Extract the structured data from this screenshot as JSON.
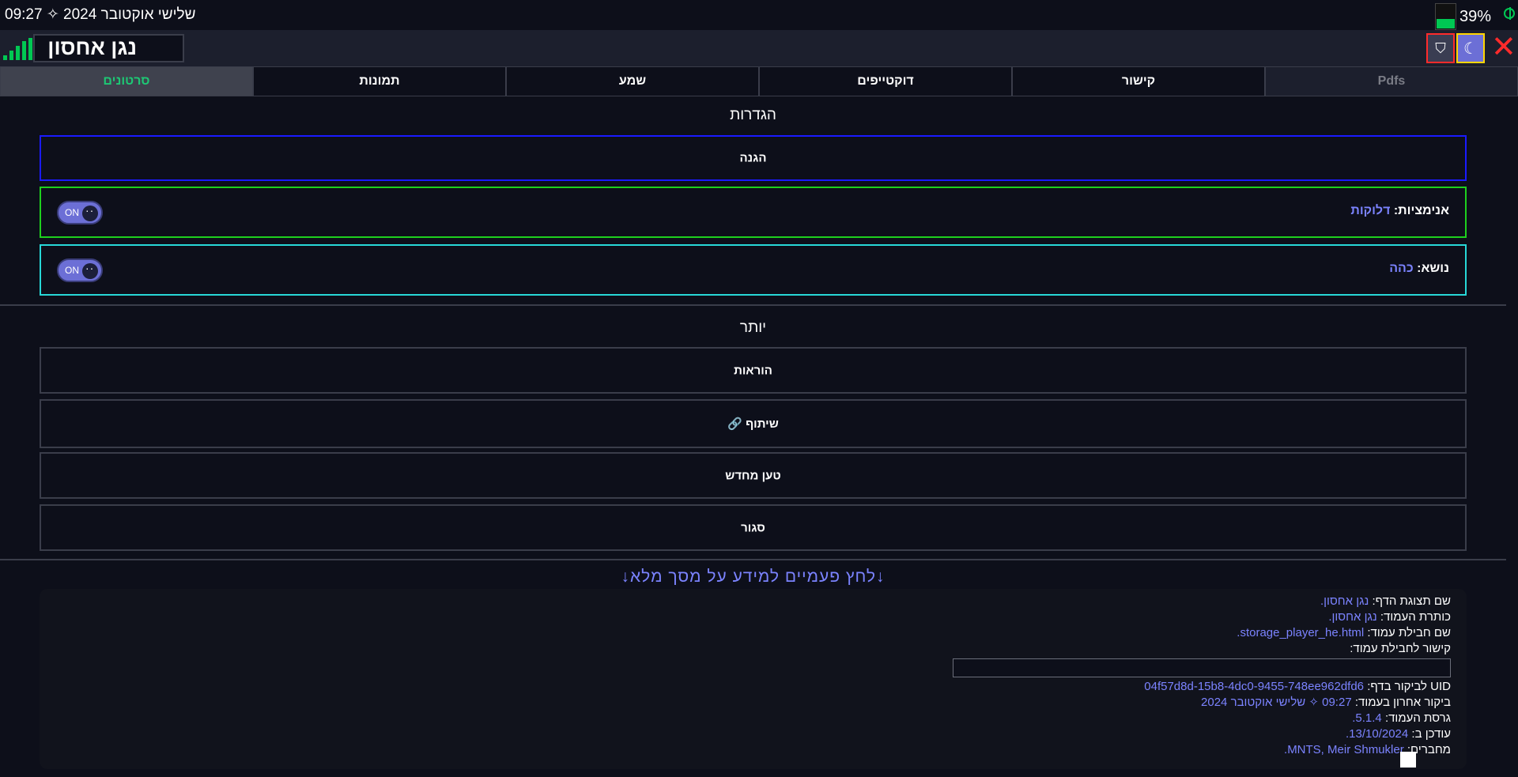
{
  "status": {
    "time": "09:27",
    "sparkle": "✧",
    "date": "שלישי אוקטובר 2024",
    "battery_percent": "39%",
    "battery_level": 0.39,
    "charging_icon": "charging-icon"
  },
  "header": {
    "title": "נגן אחסון",
    "close_icon": "✕",
    "theme_icon": "☾",
    "shield_icon": "⛉"
  },
  "tabs": [
    {
      "label": "Pdfs",
      "state": "disabled"
    },
    {
      "label": "קישור",
      "state": "normal"
    },
    {
      "label": "דוקטייפים",
      "state": "normal"
    },
    {
      "label": "שמע",
      "state": "normal"
    },
    {
      "label": "תמונות",
      "state": "normal"
    },
    {
      "label": "סרטונים",
      "state": "active"
    }
  ],
  "settings": {
    "title": "הגדרות",
    "protection_label": "הגנה",
    "animations_label": "אנימציות:",
    "animations_value": "דלוקות",
    "animations_toggle": "ON",
    "theme_label": "נושא:",
    "theme_value": "כהה",
    "theme_toggle": "ON"
  },
  "more": {
    "title": "יותר",
    "instructions": "הוראות",
    "share": "שיתוף",
    "share_icon": "🔗",
    "reload": "טען מחדש",
    "close": "סגור"
  },
  "info": {
    "hint": "↓לחץ פעמיים למידע על מסך מלא↓",
    "display_name_label": "שם תצוגת הדף:",
    "display_name_value": "נגן אחסון.",
    "page_title_label": "כותרת העמוד:",
    "page_title_value": "נגן אחסון.",
    "package_name_label": "שם חבילת עמוד:",
    "package_name_value": "storage_player_he.html.",
    "package_link_label": "קישור לחבילת עמוד:",
    "package_link_value": "",
    "uid_label": "UID לביקור בדף:",
    "uid_value": "04f57d8d-15b8-4dc0-9455-748ee962dfd6",
    "last_visit_label": "ביקור אחרון בעמוד:",
    "last_visit_value": "09:27 ✧ שלישי אוקטובר 2024",
    "version_label": "גרסת העמוד:",
    "version_value": "5.1.4.",
    "updated_label": "עודכן ב:",
    "updated_value": "13/10/2024.",
    "authors_label": "מחברים:",
    "authors_value": "MNTS, Meir Shmukler."
  },
  "colors": {
    "background": "#0d0f1a",
    "accent": "#7b83ff",
    "active_tab": "#1ec774",
    "protection_border": "#1a1aff",
    "animations_border": "#1ed01e",
    "theme_border": "#27d8d8",
    "close_red": "#ff2b2b"
  }
}
